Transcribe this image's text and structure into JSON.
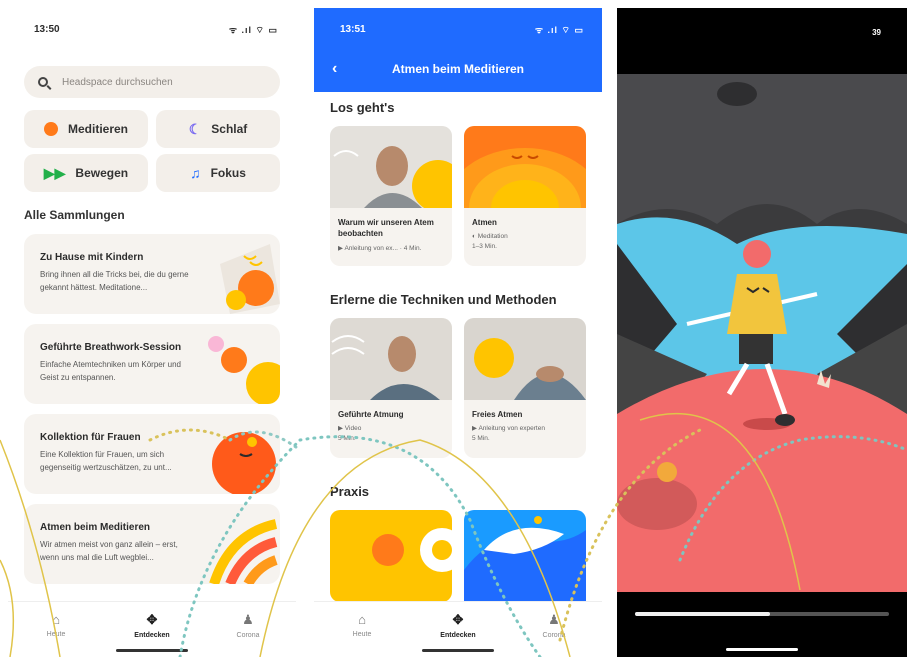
{
  "screen1": {
    "status_time": "13:50",
    "status_right": "ᯤ .ıl ⌔ ▭",
    "search_placeholder": "Headspace durchsuchen",
    "categories": [
      {
        "label": "Meditieren",
        "icon": "orange-dot-icon",
        "color": "#ff7a1a"
      },
      {
        "label": "Schlaf",
        "icon": "moon-icon",
        "color": "#7b6cf0"
      },
      {
        "label": "Bewegen",
        "icon": "fast-forward-icon",
        "color": "#22b04a"
      },
      {
        "label": "Fokus",
        "icon": "music-note-icon",
        "color": "#1f6bff"
      }
    ],
    "section_title": "Alle Sammlungen",
    "collections": [
      {
        "title": "Zu Hause mit Kindern",
        "desc": "Bring ihnen all die Tricks bei, die du gerne gekannt hättest. Meditatione..."
      },
      {
        "title": "Geführte Breathwork-Session",
        "desc": "Einfache Atemtechniken um Körper und Geist zu entspannen."
      },
      {
        "title": "Kollektion für Frauen",
        "desc": "Eine Kollektion für Frauen, um sich gegenseitig wertzuschätzen, zu unt..."
      },
      {
        "title": "Atmen beim Meditieren",
        "desc": "Wir atmen meist von ganz allein – erst, wenn uns mal die Luft wegblei..."
      }
    ],
    "tabs": [
      {
        "label": "Heute",
        "icon": "home-icon"
      },
      {
        "label": "Entdecken",
        "icon": "explore-icon"
      },
      {
        "label": "Corona",
        "icon": "person-icon"
      }
    ]
  },
  "screen2": {
    "status_time": "13:51",
    "status_right": "ᯤ .ıl ⌔ ▭",
    "back_icon": "‹",
    "header_title": "Atmen beim Meditieren",
    "sections": [
      {
        "title": "Los geht's",
        "cards": [
          {
            "title": "Warum wir unseren Atem beobachten",
            "meta1": "▶ Anleitung von ex... · 4 Min.",
            "meta2": ""
          },
          {
            "title": "Atmen",
            "meta1": "◐ Meditation",
            "meta2": "1–3 Min."
          }
        ]
      },
      {
        "title": "Erlerne die Techniken und Methoden",
        "cards": [
          {
            "title": "Geführte Atmung",
            "meta1": "▶ Video",
            "meta2": "5 Min."
          },
          {
            "title": "Freies Atmen",
            "meta1": "▶ Anleitung von experten",
            "meta2": "5 Min."
          }
        ]
      },
      {
        "title": "Praxis",
        "cards": []
      }
    ],
    "tabs": [
      {
        "label": "Heute",
        "icon": "home-icon"
      },
      {
        "label": "Entdecken",
        "icon": "explore-icon"
      },
      {
        "label": "Corona",
        "icon": "person-icon"
      }
    ]
  },
  "screen3": {
    "status_number": "39",
    "progress": 0.53
  },
  "colors": {
    "blue": "#1f6bff",
    "orange": "#ff7a1a",
    "yellow": "#ffc400",
    "cream": "#f3efea"
  }
}
